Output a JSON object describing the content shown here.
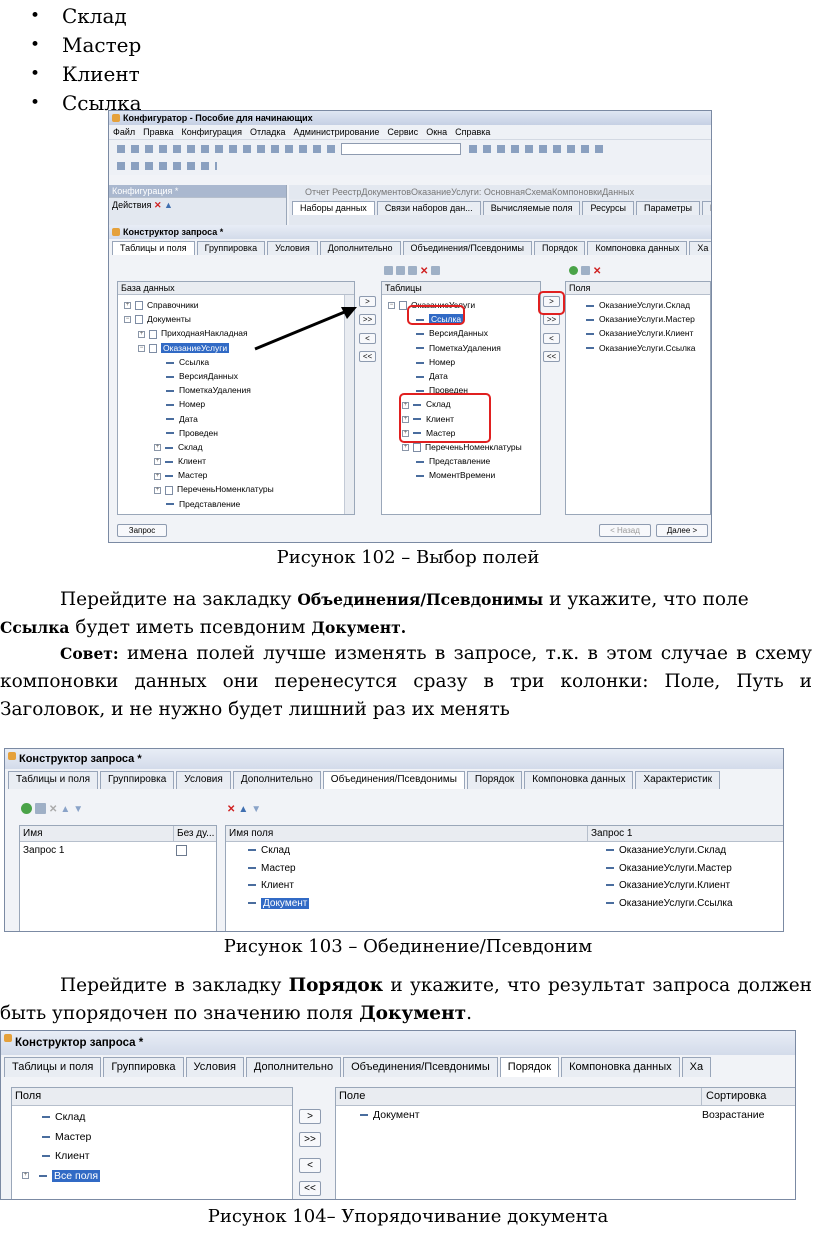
{
  "bullets": [
    "Склад",
    "Мастер",
    "Клиент",
    "Ссылка"
  ],
  "fig102": {
    "app_title": "Конфигуратор - Пособие для начинающих",
    "menu": [
      "Файл",
      "Правка",
      "Конфигурация",
      "Отладка",
      "Администрирование",
      "Сервис",
      "Окна",
      "Справка"
    ],
    "config_panel_title": "Конфигурация *",
    "actions_label": "Действия",
    "report_tab_title": "Отчет РеестрДокументовОказаниеУслуги: ОсновнаяСхемаКомпоновкиДанных",
    "report_tabs": [
      "Наборы данных",
      "Связи наборов дан...",
      "Вычисляемые поля",
      "Ресурсы",
      "Параметры",
      "Н"
    ],
    "query_title": "Конструктор запроса *",
    "query_tabs": [
      "Таблицы и поля",
      "Группировка",
      "Условия",
      "Дополнительно",
      "Объединения/Псевдонимы",
      "Порядок",
      "Компоновка данных",
      "Ха"
    ],
    "db_header": "База данных",
    "db_rows": [
      "Справочники",
      "Документы",
      "ПриходнаяНакладная",
      "ОказаниеУслуги",
      "Ссылка",
      "ВерсияДанных",
      "ПометкаУдаления",
      "Номер",
      "Дата",
      "Проведен",
      "Склад",
      "Клиент",
      "Мастер",
      "ПереченьНоменклатуры",
      "Представление"
    ],
    "tables_header": "Таблицы",
    "tables_rows": [
      "ОказаниеУслуги",
      "Ссылка",
      "ВерсияДанных",
      "ПометкаУдаления",
      "Номер",
      "Дата",
      "Проведен",
      "Склад",
      "Клиент",
      "Мастер",
      "ПереченьНоменклатуры",
      "Представление",
      "МоментВремени"
    ],
    "fields_header": "Поля",
    "fields_rows": [
      "ОказаниеУслуги.Склад",
      "ОказаниеУслуги.Мастер",
      "ОказаниеУслуги.Клиент",
      "ОказаниеУслуги.Ссылка"
    ],
    "btn_add": ">",
    "btn_add_all": ">>",
    "btn_remove": "<",
    "btn_remove_all": "<<",
    "btn_query": "Запрос",
    "btn_back": "< Назад",
    "btn_next": "Далее >"
  },
  "caption102": "Рисунок 102 – Выбор полей",
  "para1": {
    "t1": "Перейдите на закладку ",
    "b1": "Объединения/Псевдонимы",
    "t2": " и укажите, что поле",
    "b2": "Ссылка",
    "t3": " будет иметь псевдоним ",
    "b3": "Документ."
  },
  "para2": {
    "b1": "Совет:",
    "t1": " имена полей лучше изменять в запросе, т.к. в этом случае в схему компоновки данных они перенесутся сразу в три колонки: Поле, Путь и Заголовок, и не нужно будет лишний раз их менять"
  },
  "fig103": {
    "title": "Конструктор запроса *",
    "tabs": [
      "Таблицы и поля",
      "Группировка",
      "Условия",
      "Дополнительно",
      "Объединения/Псевдонимы",
      "Порядок",
      "Компоновка данных",
      "Характеристик"
    ],
    "left_headers": [
      "Имя",
      "Без ду..."
    ],
    "left_rows": [
      "Запрос 1"
    ],
    "right_headers": [
      "Имя поля",
      "Запрос 1"
    ],
    "names": [
      "Склад",
      "Мастер",
      "Клиент",
      "Документ"
    ],
    "values": [
      "ОказаниеУслуги.Склад",
      "ОказаниеУслуги.Мастер",
      "ОказаниеУслуги.Клиент",
      "ОказаниеУслуги.Ссылка"
    ]
  },
  "caption103": "Рисунок 103 – Обединение/Псевдоним",
  "para3": {
    "t1": "Перейдите в закладку ",
    "b1": "Порядок",
    "t2": " и укажите, что результат запроса должен быть упорядочен по значению поля ",
    "b2": "Документ",
    "t3": "."
  },
  "fig104": {
    "title": "Конструктор запроса *",
    "tabs": [
      "Таблицы и поля",
      "Группировка",
      "Условия",
      "Дополнительно",
      "Объединения/Псевдонимы",
      "Порядок",
      "Компоновка данных",
      "Ха"
    ],
    "fields_header": "Поля",
    "fields": [
      "Склад",
      "Мастер",
      "Клиент",
      "Все поля"
    ],
    "right_headers": [
      "Поле",
      "Сортировка"
    ],
    "order_field": "Документ",
    "order_dir": "Возрастание"
  },
  "caption104": "Рисунок 104– Упорядочивание документа"
}
